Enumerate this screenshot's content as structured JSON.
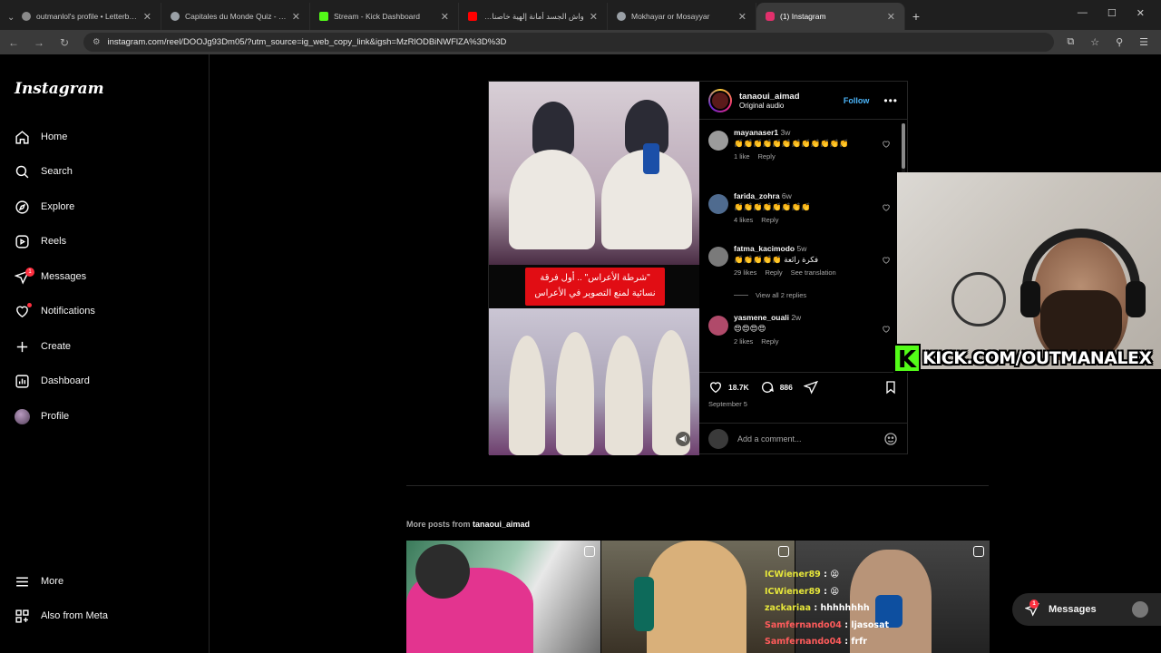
{
  "browser": {
    "tabs": [
      {
        "title": "outmanlol's profile • Letterboxd",
        "color": "#8a8a8a"
      },
      {
        "title": "Capitales du Monde Quiz - Jeu",
        "color": "#9aa0a6"
      },
      {
        "title": "Stream - Kick Dashboard",
        "color": "#53fc18"
      },
      {
        "title": "واش الجسد أمانة إلهية خاصنا نحاف",
        "color": "#ff0000"
      },
      {
        "title": "Mokhayar or Mosayyar",
        "color": "#9aa0a6"
      },
      {
        "title": "(1) Instagram",
        "color": "#e1306c"
      }
    ],
    "url": "instagram.com/reel/DOOJg93Dm05/?utm_source=ig_web_copy_link&igsh=MzRlODBiNWFlZA%3D%3D"
  },
  "sidebar": {
    "logo": "Instagram",
    "items": [
      {
        "label": "Home",
        "icon": "home-icon"
      },
      {
        "label": "Search",
        "icon": "search-icon"
      },
      {
        "label": "Explore",
        "icon": "compass-icon"
      },
      {
        "label": "Reels",
        "icon": "reels-icon"
      },
      {
        "label": "Messages",
        "icon": "messenger-icon",
        "badge": "1"
      },
      {
        "label": "Notifications",
        "icon": "heart-icon"
      },
      {
        "label": "Create",
        "icon": "plus-icon"
      },
      {
        "label": "Dashboard",
        "icon": "dashboard-icon"
      },
      {
        "label": "Profile",
        "icon": "avatar"
      }
    ],
    "more": "More",
    "also_meta": "Also from Meta"
  },
  "post": {
    "username": "tanaoui_aimad",
    "audio": "Original audio",
    "follow": "Follow",
    "caption_line1": "\"شرطة الأعراس\" .. أول فرقة",
    "caption_line2": "نسائية لمنع التصوير في الأعراس",
    "likes": "18.7K",
    "comments_count": "886",
    "date": "September 5",
    "add_comment_placeholder": "Add a comment...",
    "view_replies": "View all 2 replies"
  },
  "comments": [
    {
      "user": "mayanaser1",
      "time": "3w",
      "text": "👏👏👏👏👏👏👏👏👏👏👏👏",
      "likes": "1 like",
      "reply": "Reply",
      "avatar": "#9b9b9b"
    },
    {
      "user": "farida_zohra",
      "time": "6w",
      "text": "👏👏👏👏👏👏👏👏",
      "likes": "4 likes",
      "reply": "Reply",
      "avatar": "#4f6b8f"
    },
    {
      "user": "fatma_kacimodo",
      "time": "5w",
      "text": "👏👏👏👏👏 فكرة رائعة",
      "likes": "29 likes",
      "reply": "Reply",
      "translate": "See translation",
      "avatar": "#7a7a7a"
    },
    {
      "user": "yasmene_ouali",
      "time": "2w",
      "text": "😍😍😍😍",
      "likes": "2 likes",
      "reply": "Reply",
      "avatar": "#b04a6a"
    }
  ],
  "overlay": {
    "kick_text": "KICK.COM/OUTMANALEX",
    "kick_color": "#53fc18"
  },
  "more_posts": {
    "prefix": "More posts from",
    "user": "tanaoui_aimad"
  },
  "chat": [
    {
      "user": "ICWiener89",
      "sep": " : ",
      "text": "😫",
      "red": false
    },
    {
      "user": "ICWiener89",
      "sep": " : ",
      "text": "😫",
      "red": false
    },
    {
      "user": "zackariaa",
      "sep": " : ",
      "text": "hhhhhhhh",
      "red": false
    },
    {
      "user": "Samfernando04",
      "sep": " : ",
      "text": "ljasosat",
      "red": true
    },
    {
      "user": "Samfernando04",
      "sep": " : ",
      "text": "frfr",
      "red": true
    }
  ],
  "messages_pill": {
    "label": "Messages",
    "badge": "1"
  }
}
